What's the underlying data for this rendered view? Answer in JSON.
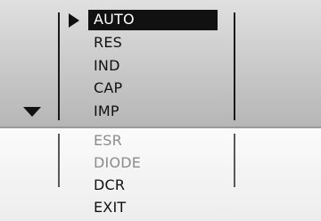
{
  "menu": {
    "items": [
      {
        "label": "AUTO",
        "selected": true
      },
      {
        "label": "RES"
      },
      {
        "label": "IND"
      },
      {
        "label": "CAP"
      },
      {
        "label": "IMP"
      },
      {
        "label": "ESR"
      },
      {
        "label": "DIODE"
      },
      {
        "label": "DCR"
      },
      {
        "label": "EXIT"
      }
    ],
    "icons": {
      "cursor": "triangle-right-icon",
      "scroll": "triangle-down-icon"
    }
  },
  "colors": {
    "highlight": "#111111",
    "highlight_text": "#ffffff",
    "dim_text": "#8c8c8c"
  }
}
